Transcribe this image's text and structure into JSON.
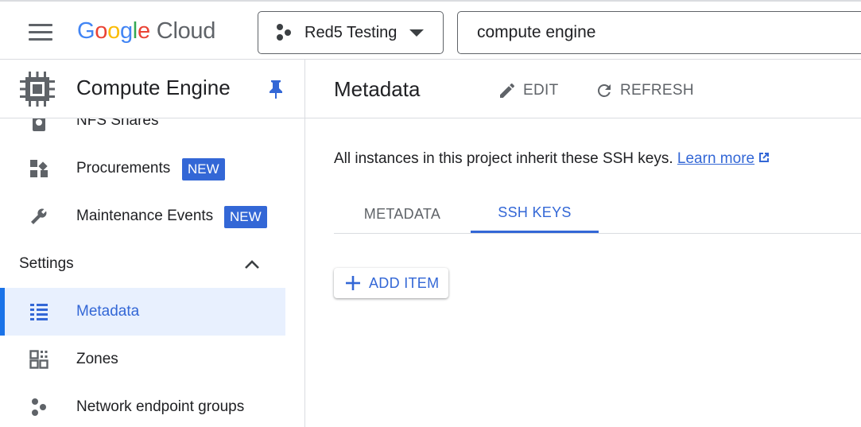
{
  "header": {
    "logo": {
      "g": "G",
      "o1": "o",
      "o2": "o",
      "g2": "g",
      "l": "l",
      "e": "e",
      "cloud": "Cloud"
    },
    "project_name": "Red5 Testing",
    "search_value": "compute engine"
  },
  "sidebar": {
    "title": "Compute Engine",
    "items": [
      {
        "label": "NFS Shares",
        "icon": "storage-icon"
      },
      {
        "label": "Procurements",
        "icon": "procurements-icon",
        "badge": "NEW"
      },
      {
        "label": "Maintenance Events",
        "icon": "wrench-icon",
        "badge": "NEW"
      }
    ],
    "settings_label": "Settings",
    "settings_items": [
      {
        "label": "Metadata",
        "icon": "metadata-list-icon",
        "active": true
      },
      {
        "label": "Zones",
        "icon": "zones-grid-icon"
      },
      {
        "label": "Network endpoint groups",
        "icon": "network-endpoint-icon"
      }
    ]
  },
  "main": {
    "title": "Metadata",
    "edit_label": "EDIT",
    "refresh_label": "REFRESH",
    "info_text": "All instances in this project inherit these SSH keys.",
    "learn_more": "Learn more",
    "tabs": [
      {
        "label": "METADATA",
        "active": false
      },
      {
        "label": "SSH KEYS",
        "active": true
      }
    ],
    "add_item_label": "ADD ITEM"
  },
  "colors": {
    "accent": "#3367d6",
    "active_bg": "#e8f0fe",
    "divider": "#dadce0",
    "icon_gray": "#5f6368"
  }
}
